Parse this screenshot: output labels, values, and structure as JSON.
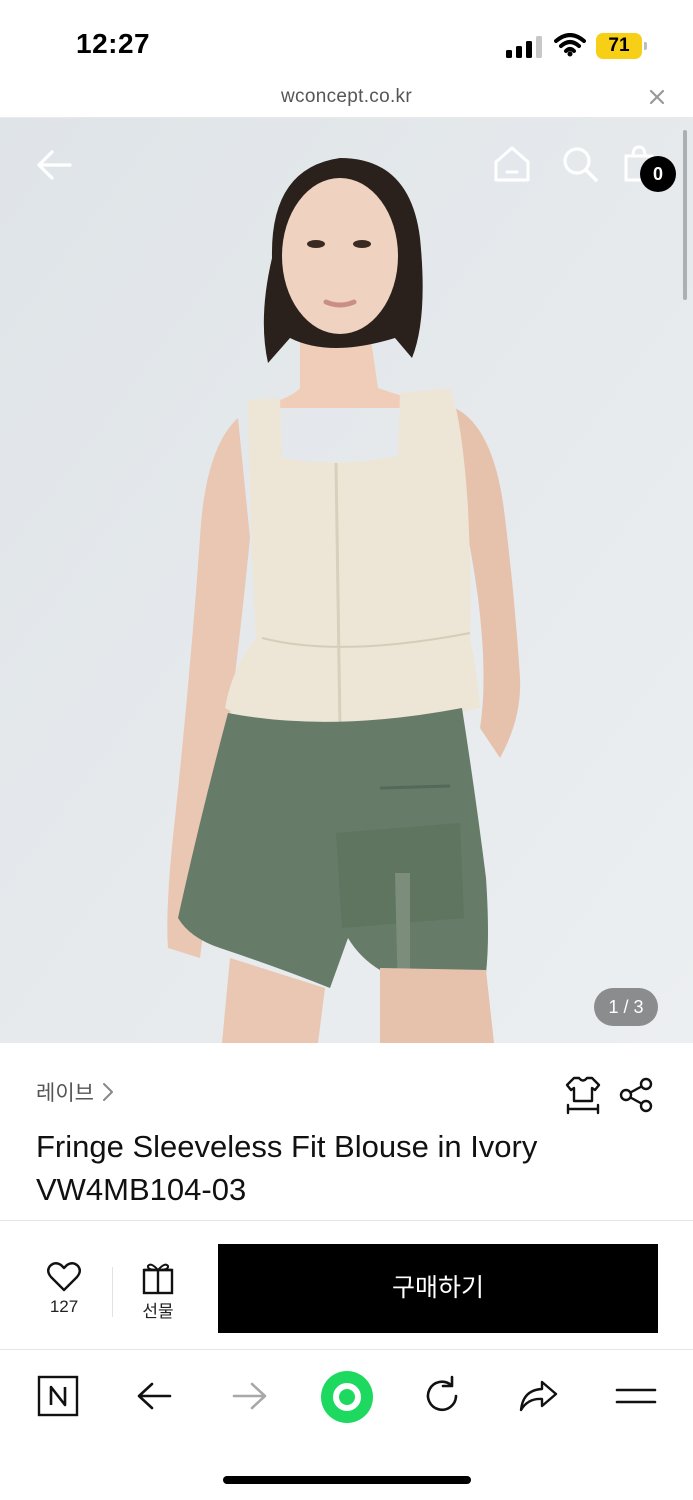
{
  "status_bar": {
    "time": "12:27",
    "battery_level": "71",
    "icons": [
      "cellular-signal-icon",
      "wifi-icon",
      "battery-icon"
    ]
  },
  "browser": {
    "url": "wconcept.co.kr",
    "toolbar_icons": [
      "naver-n-icon",
      "back-arrow-icon",
      "forward-arrow-icon",
      "green-dot-icon",
      "reload-icon",
      "share-icon",
      "menu-icon"
    ]
  },
  "header": {
    "cart_count": "0",
    "icons": [
      "back-arrow-icon",
      "home-icon",
      "search-icon",
      "shopping-bag-icon"
    ]
  },
  "gallery": {
    "page_indicator": "1 / 3"
  },
  "product": {
    "brand": "레이브",
    "name": "Fringe Sleeveless Fit Blouse in Ivory VW4MB104-03"
  },
  "actions": {
    "wish_count": "127",
    "gift_label": "선물",
    "buy_label": "구매하기"
  },
  "colors": {
    "accent_battery": "#f7cf17",
    "buy_button": "#000000",
    "green_dot": "#1ed95f"
  }
}
